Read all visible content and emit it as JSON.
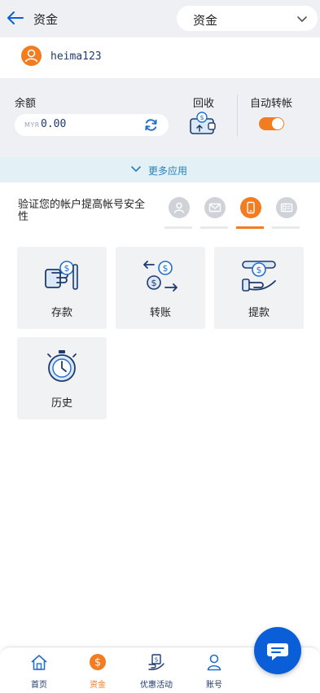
{
  "header": {
    "title": "资金",
    "select_value": "资金"
  },
  "user": {
    "username": "heima123"
  },
  "balance": {
    "label": "余额",
    "currency": "MYR",
    "amount": "0.00",
    "recycle_label": "回收",
    "auto_transfer_label": "自动转帐",
    "auto_transfer_on": true
  },
  "more_apps": {
    "label": "更多应用"
  },
  "verify": {
    "text": "验证您的帐户提高帐号安全性",
    "items": [
      {
        "name": "profile",
        "icon": "person-icon",
        "active": false
      },
      {
        "name": "email",
        "icon": "mail-icon",
        "active": false
      },
      {
        "name": "phone",
        "icon": "phone-icon",
        "active": true
      },
      {
        "name": "id-card",
        "icon": "id-card-icon",
        "active": false
      }
    ]
  },
  "tiles": [
    {
      "label": "存款",
      "icon": "deposit-icon"
    },
    {
      "label": "转账",
      "icon": "transfer-icon"
    },
    {
      "label": "提款",
      "icon": "withdraw-icon"
    },
    {
      "label": "历史",
      "icon": "history-icon"
    }
  ],
  "nav": [
    {
      "label": "首页",
      "icon": "home-icon"
    },
    {
      "label": "资金",
      "icon": "funds-icon",
      "active": true
    },
    {
      "label": "优惠活动",
      "icon": "promotion-icon"
    },
    {
      "label": "账号",
      "icon": "account-icon"
    }
  ],
  "colors": {
    "accent": "#f37b20",
    "brand_blue": "#0a5fd8",
    "navy": "#1f3a6e",
    "panel": "#eef0f4"
  }
}
